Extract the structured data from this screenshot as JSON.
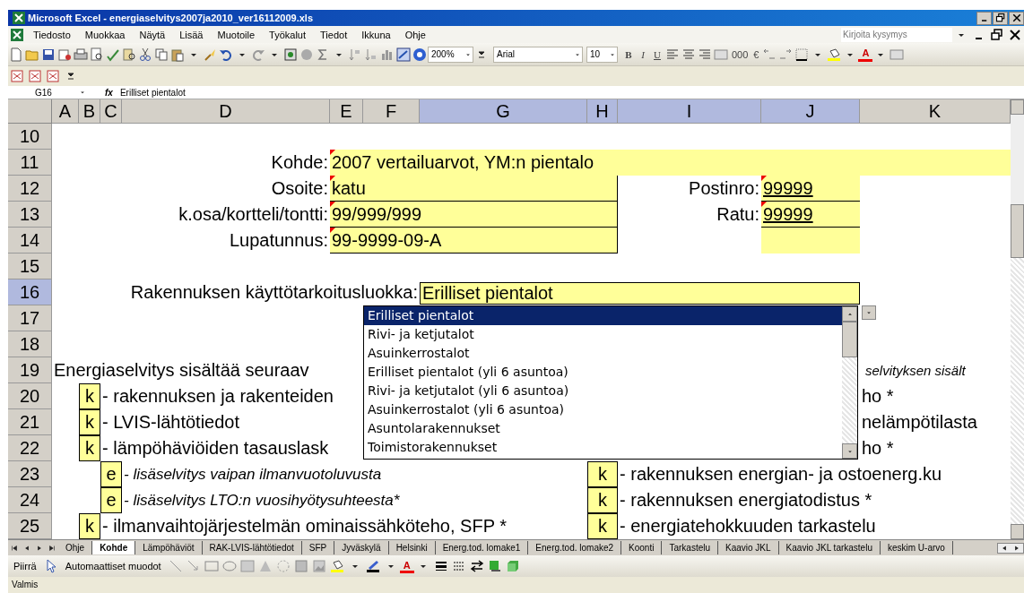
{
  "window": {
    "title": "Microsoft Excel - energiaselvitys2007ja2010_ver16112009.xls"
  },
  "menu": [
    "Tiedosto",
    "Muokkaa",
    "Näytä",
    "Lisää",
    "Muotoile",
    "Työkalut",
    "Tiedot",
    "Ikkuna",
    "Ohje"
  ],
  "help_box": {
    "placeholder": "Kirjoita kysymys"
  },
  "toolbar": {
    "zoom": "200%",
    "font": "Arial",
    "size": "10",
    "format_buttons": [
      {
        "label": "B",
        "kind": "bold"
      },
      {
        "label": "I",
        "kind": "italic"
      },
      {
        "label": "U",
        "kind": "underline"
      }
    ],
    "number_buttons": [
      "000",
      "€"
    ],
    "font_color_label": "A"
  },
  "formula_bar": {
    "name_box": "G16",
    "fx": "fx",
    "value": "Erilliset pientalot"
  },
  "columns": [
    {
      "label": "A",
      "selected": false
    },
    {
      "label": "B",
      "selected": false
    },
    {
      "label": "C",
      "selected": false
    },
    {
      "label": "D",
      "selected": false
    },
    {
      "label": "E",
      "selected": false
    },
    {
      "label": "F",
      "selected": false
    },
    {
      "label": "G",
      "selected": true
    },
    {
      "label": "H",
      "selected": true
    },
    {
      "label": "I",
      "selected": true
    },
    {
      "label": "J",
      "selected": true
    },
    {
      "label": "K",
      "selected": false
    }
  ],
  "rows": [
    {
      "number": "10",
      "selected": false,
      "cells": {}
    },
    {
      "number": "11",
      "selected": false,
      "cells": {
        "D": {
          "kind": "label",
          "text": "Kohde:"
        },
        "E": {
          "kind": "input",
          "text": "2007 vertailuarvot, YM:n pientalo",
          "comment": true
        }
      }
    },
    {
      "number": "12",
      "selected": false,
      "cells": {
        "D": {
          "kind": "label",
          "text": "Osoite:"
        },
        "E": {
          "kind": "field",
          "text": "katu",
          "comment": true
        },
        "I": {
          "kind": "label",
          "text": "Postinro:"
        },
        "J": {
          "kind": "link",
          "text": "99999",
          "comment": true
        }
      }
    },
    {
      "number": "13",
      "selected": false,
      "cells": {
        "D": {
          "kind": "label",
          "text": "k.osa/kortteli/tontti:"
        },
        "E": {
          "kind": "field",
          "text": "99/999/999",
          "comment": true
        },
        "I": {
          "kind": "label",
          "text": "Ratu:"
        },
        "J": {
          "kind": "link",
          "text": "99999",
          "comment": true
        }
      }
    },
    {
      "number": "14",
      "selected": false,
      "cells": {
        "D": {
          "kind": "label",
          "text": "Lupatunnus:"
        },
        "E": {
          "kind": "field",
          "text": "99-9999-09-A",
          "comment": true
        },
        "J": {
          "kind": "blank"
        }
      }
    },
    {
      "number": "15",
      "selected": false,
      "cells": {}
    },
    {
      "number": "16",
      "selected": true,
      "cells": {
        "B": {
          "kind": "label",
          "text": "Rakennuksen käyttötarkoitusluokka:"
        },
        "G": {
          "kind": "select",
          "text": "Erilliset pientalot"
        }
      }
    },
    {
      "number": "17",
      "selected": false,
      "cells": {}
    },
    {
      "number": "18",
      "selected": false,
      "cells": {}
    },
    {
      "number": "19",
      "selected": false,
      "cells": {
        "A": {
          "kind": "text",
          "text": "Energiaselvitys sisältää seuraav"
        },
        "K": {
          "kind": "note",
          "text": "selvityksen sisält"
        }
      }
    },
    {
      "number": "20",
      "selected": false,
      "cells": {
        "B": {
          "kind": "flag",
          "text": "k"
        },
        "C": {
          "kind": "text",
          "text": "- rakennuksen ja rakenteiden"
        },
        "K": {
          "kind": "text",
          "text": "ho *"
        }
      }
    },
    {
      "number": "21",
      "selected": false,
      "cells": {
        "B": {
          "kind": "flag",
          "text": "k"
        },
        "C": {
          "kind": "text",
          "text": "- LVIS-lähtötiedot"
        },
        "K": {
          "kind": "text",
          "text": "nelämpötilasta"
        }
      }
    },
    {
      "number": "22",
      "selected": false,
      "cells": {
        "B": {
          "kind": "flag",
          "text": "k"
        },
        "C": {
          "kind": "text",
          "text": "- lämpöhäviöiden tasauslask"
        },
        "K": {
          "kind": "text",
          "text": "ho *"
        }
      }
    },
    {
      "number": "23",
      "selected": false,
      "cells": {
        "C": {
          "kind": "flag",
          "text": "e"
        },
        "D": {
          "kind": "italic",
          "text": "- lisäselvitys vaipan ilmanvuotoluvusta"
        },
        "H": {
          "kind": "flag",
          "text": "k"
        },
        "I": {
          "kind": "text",
          "text": "- rakennuksen energian- ja ostoenerg.ku"
        }
      }
    },
    {
      "number": "24",
      "selected": false,
      "cells": {
        "C": {
          "kind": "flag",
          "text": "e"
        },
        "D": {
          "kind": "italic",
          "text": "- lisäselvitys LTO:n vuosihyötysuhteesta*"
        },
        "H": {
          "kind": "flag",
          "text": "k"
        },
        "I": {
          "kind": "text",
          "text": "- rakennuksen energiatodistus *"
        }
      }
    },
    {
      "number": "25",
      "selected": false,
      "cells": {
        "B": {
          "kind": "flag",
          "text": "k"
        },
        "C": {
          "kind": "text",
          "text": "- ilmanvaihtojärjestelmän ominaissähköteho, SFP *"
        },
        "H": {
          "kind": "flag",
          "text": "k"
        },
        "I": {
          "kind": "text",
          "text": "- energiatehokkuuden tarkastelu"
        }
      }
    }
  ],
  "dropdown": [
    {
      "label": "Erilliset pientalot",
      "selected": true
    },
    {
      "label": "Rivi- ja ketjutalot",
      "selected": false
    },
    {
      "label": "Asuinkerrostalot",
      "selected": false
    },
    {
      "label": "Erilliset pientalot (yli 6 asuntoa)",
      "selected": false
    },
    {
      "label": "Rivi- ja ketjutalot (yli 6 asuntoa)",
      "selected": false
    },
    {
      "label": "Asuinkerrostalot (yli 6 asuntoa)",
      "selected": false
    },
    {
      "label": "Asuntolarakennukset",
      "selected": false
    },
    {
      "label": "Toimistorakennukset",
      "selected": false
    }
  ],
  "sheet_tabs": [
    {
      "label": "Ohje",
      "selected": false
    },
    {
      "label": "Kohde",
      "selected": true
    },
    {
      "label": "Lämpöhäviöt",
      "selected": false
    },
    {
      "label": "RAK-LVIS-lähtötiedot",
      "selected": false
    },
    {
      "label": "SFP",
      "selected": false
    },
    {
      "label": "Jyväskylä",
      "selected": false
    },
    {
      "label": "Helsinki",
      "selected": false
    },
    {
      "label": "Energ.tod. lomake1",
      "selected": false
    },
    {
      "label": "Energ.tod. lomake2",
      "selected": false
    },
    {
      "label": "Koonti",
      "selected": false
    },
    {
      "label": "Tarkastelu",
      "selected": false
    },
    {
      "label": "Kaavio JKL",
      "selected": false
    },
    {
      "label": "Kaavio JKL tarkastelu",
      "selected": false
    },
    {
      "label": "keskim U-arvo",
      "selected": false
    }
  ],
  "drawing_toolbar": {
    "draw_menu": "Piirrä",
    "shapes_menu": "Automaattiset muodot",
    "font_color_label": "A"
  },
  "status_bar": {
    "text": "Valmis"
  }
}
